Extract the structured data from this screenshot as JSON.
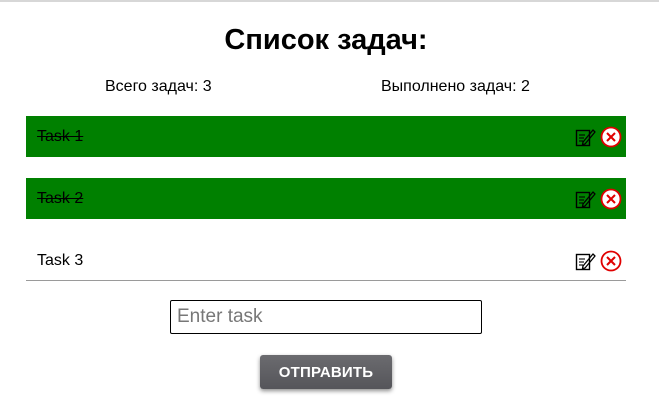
{
  "header": {
    "title": "Список задач:"
  },
  "stats": {
    "total_label": "Всего задач: 3",
    "done_label": "Выполнено задач: 2"
  },
  "tasks": [
    {
      "text": "Task 1",
      "completed": true
    },
    {
      "text": "Task 2",
      "completed": true
    },
    {
      "text": "Task 3",
      "completed": false
    }
  ],
  "form": {
    "input_placeholder": "Enter task",
    "input_value": "",
    "submit_label": "ОТПРАВИТЬ"
  },
  "icons": {
    "edit": "edit-icon",
    "delete": "delete-icon"
  },
  "colors": {
    "completed_row": "#008000",
    "delete_icon": "#e00000",
    "button": "#5f5f63"
  }
}
